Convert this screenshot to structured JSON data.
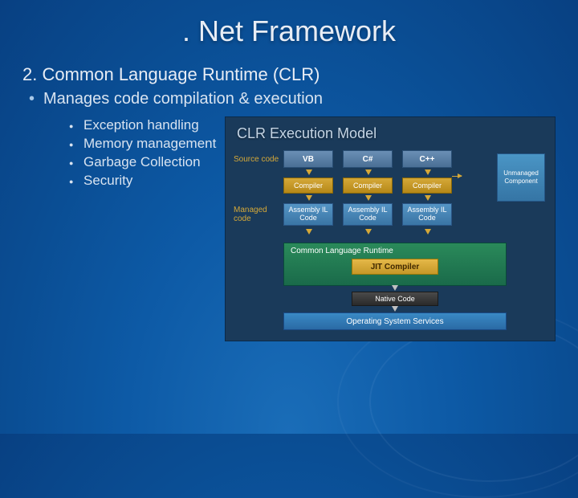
{
  "title": ". Net Framework",
  "section": {
    "heading": "2. Common Language Runtime (CLR)",
    "main_bullet": "Manages code compilation & execution",
    "sub_bullets": [
      "Exception handling",
      "Memory management",
      "Garbage Collection",
      "Security"
    ]
  },
  "diagram": {
    "title": "CLR Execution Model",
    "labels": {
      "source": "Source code",
      "managed": "Managed code"
    },
    "languages": [
      "VB",
      "C#",
      "C++"
    ],
    "compiler": "Compiler",
    "assembly": "Assembly IL Code",
    "unmanaged": "Unmanaged Component",
    "clr": "Common Language Runtime",
    "jit": "JIT Compiler",
    "native": "Native Code",
    "os": "Operating System Services"
  }
}
